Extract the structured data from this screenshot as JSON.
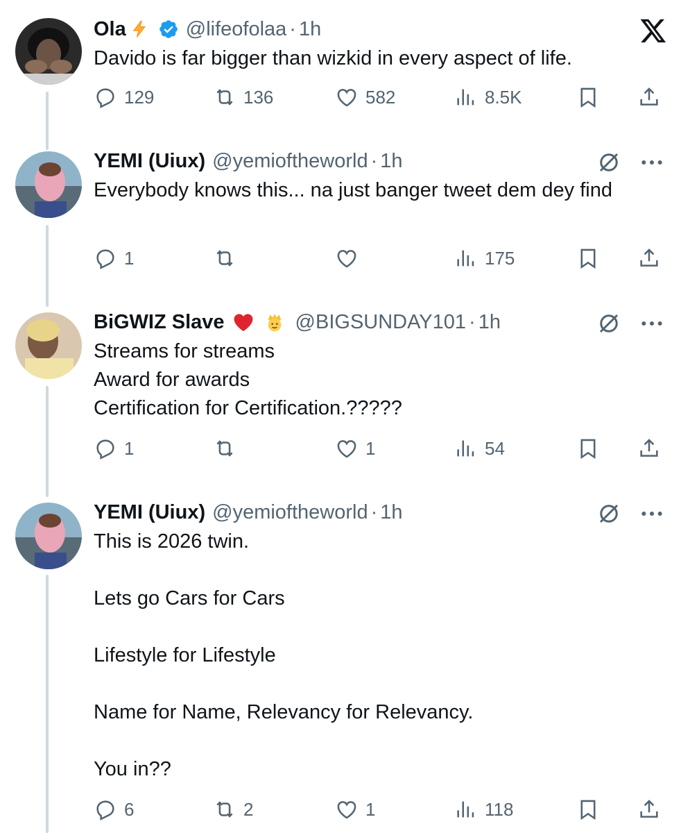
{
  "brand": {
    "logo_icon": "x-logo-icon"
  },
  "colors": {
    "text": "#0f1419",
    "muted": "#536471",
    "verified": "#1d9bf0",
    "thread_line": "#cfd9de"
  },
  "tweets": [
    {
      "display_name": "Ola",
      "emojis": [
        "high-voltage-emoji"
      ],
      "verified": true,
      "handle": "@lifeofolaa",
      "separator": "·",
      "time": "1h",
      "text": "Davido is far bigger than wizkid in every aspect of life.",
      "reply_count": "129",
      "retweet_count": "136",
      "like_count": "582",
      "view_count": "8.5K"
    },
    {
      "display_name": "YEMI (Uiux)",
      "emojis": [],
      "verified": false,
      "handle": "@yemioftheworld",
      "separator": "·",
      "time": "1h",
      "text": "Everybody knows this... na just banger tweet dem dey find",
      "reply_count": "1",
      "retweet_count": "",
      "like_count": "",
      "view_count": "175"
    },
    {
      "display_name": "BiGWIZ Slave",
      "emojis": [
        "red-heart-emoji",
        "prince-emoji"
      ],
      "verified": false,
      "handle": "@BIGSUNDAY101",
      "separator": "·",
      "time": "1h",
      "text": "Streams for streams\nAward for awards\nCertification for Certification.?????",
      "reply_count": "1",
      "retweet_count": "",
      "like_count": "1",
      "view_count": "54"
    },
    {
      "display_name": "YEMI (Uiux)",
      "emojis": [],
      "verified": false,
      "handle": "@yemioftheworld",
      "separator": "·",
      "time": "1h",
      "text": "This is 2026 twin.\n\nLets go Cars for Cars\n\nLifestyle for Lifestyle\n\nName for Name, Relevancy for Relevancy.\n\nYou in??",
      "reply_count": "6",
      "retweet_count": "2",
      "like_count": "1",
      "view_count": "118"
    }
  ]
}
